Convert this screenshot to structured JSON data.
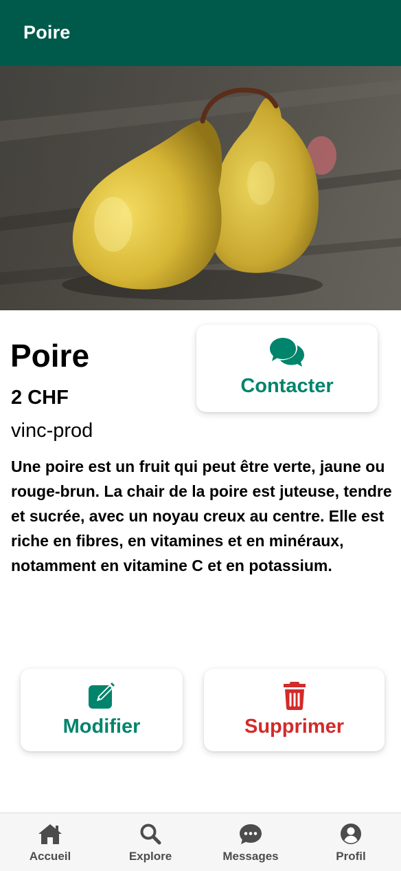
{
  "app_bar": {
    "title": "Poire"
  },
  "product": {
    "name": "Poire",
    "price": "2 CHF",
    "seller": "vinc-prod",
    "description": "Une poire est un fruit qui peut être verte, jaune ou rouge-brun. La chair de la poire est juteuse, tendre et sucrée, avec un noyau creux au centre. Elle est riche en fibres, en vitamines et en minéraux, notamment en vitamine C et en potassium."
  },
  "actions": {
    "contact": {
      "label": "Contacter",
      "icon": "chat-bubbles-icon"
    },
    "edit": {
      "label": "Modifier",
      "icon": "edit-icon"
    },
    "delete": {
      "label": "Supprimer",
      "icon": "trash-icon"
    }
  },
  "bottom_nav": {
    "items": [
      {
        "label": "Accueil",
        "icon": "home-icon"
      },
      {
        "label": "Explore",
        "icon": "search-icon"
      },
      {
        "label": "Messages",
        "icon": "messages-icon"
      },
      {
        "label": "Profil",
        "icon": "profile-icon"
      }
    ]
  },
  "colors": {
    "app_bar": "#005a4b",
    "accent_green": "#00846c",
    "danger_red": "#d32a2a",
    "nav_text": "#4c4c4c"
  }
}
